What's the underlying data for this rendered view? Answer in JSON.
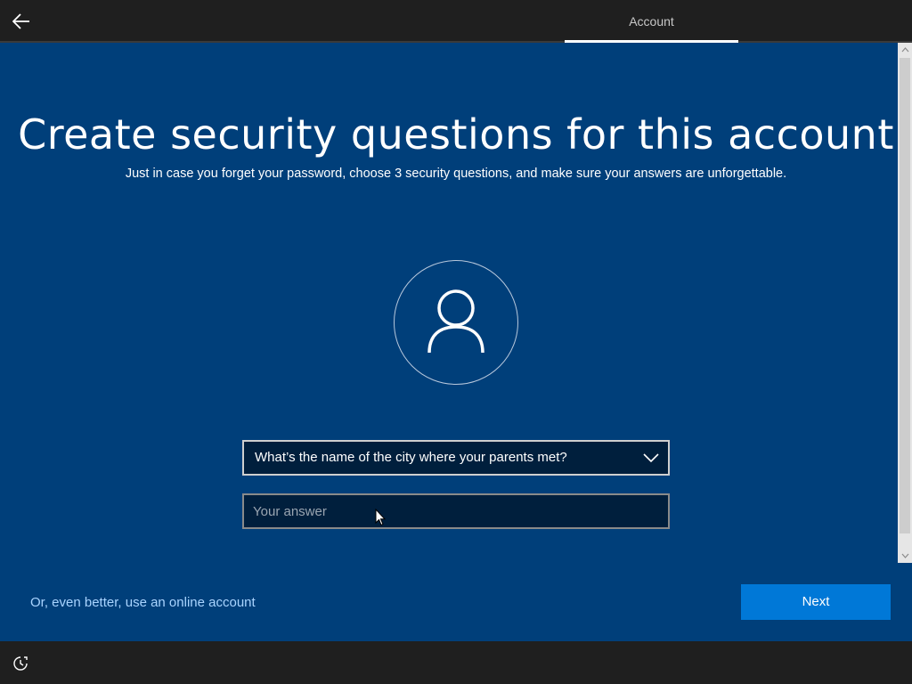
{
  "header": {
    "back_icon": "arrow-left-icon",
    "tab_label": "Account"
  },
  "main": {
    "title": "Create security questions for this account",
    "subtitle": "Just in case you forget your password, choose 3 security questions, and make sure your answers are unforgettable.",
    "avatar_icon": "person-icon",
    "question_select": {
      "selected": "What’s the name of the city where your parents met?",
      "icon": "chevron-down-icon"
    },
    "answer_input": {
      "value": "",
      "placeholder": "Your answer"
    },
    "online_account_link": "Or, even better, use an online account",
    "next_label": "Next"
  },
  "footer": {
    "accessibility_icon": "ease-of-access-icon"
  },
  "colors": {
    "background": "#003f7a",
    "bar": "#1f1f1f",
    "accent": "#0078d7",
    "link": "#a9d4ff",
    "field": "#001f3d"
  }
}
